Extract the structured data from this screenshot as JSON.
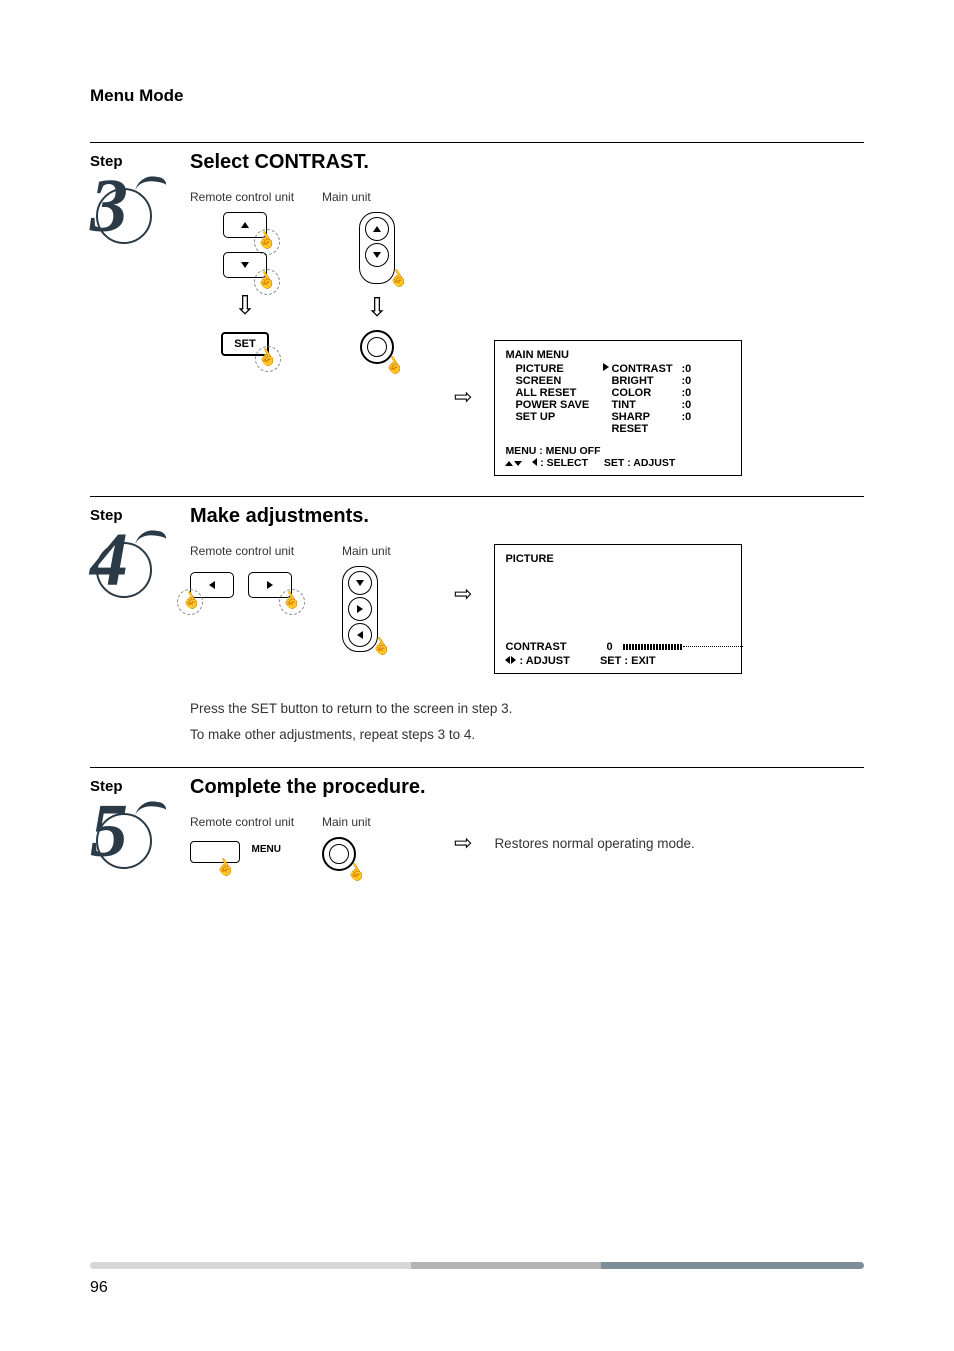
{
  "header": "Menu Mode",
  "page_number": "96",
  "labels": {
    "step": "Step",
    "remote": "Remote control unit",
    "main": "Main unit",
    "set": "SET",
    "menu": "MENU"
  },
  "step3": {
    "heading": "Select CONTRAST.",
    "osd": {
      "title": "MAIN MENU",
      "left": [
        "PICTURE",
        "SCREEN",
        "ALL RESET",
        "POWER SAVE",
        "SET UP"
      ],
      "right": [
        {
          "k": "CONTRAST",
          "c": ":",
          "v": "0",
          "sel": true
        },
        {
          "k": "BRIGHT",
          "c": ":",
          "v": "0"
        },
        {
          "k": "COLOR",
          "c": ":",
          "v": "0"
        },
        {
          "k": "TINT",
          "c": ":",
          "v": "0"
        },
        {
          "k": "SHARP",
          "c": ":",
          "v": "0"
        },
        {
          "k": "RESET",
          "c": "",
          "v": ""
        }
      ],
      "foot1": "MENU : MENU OFF",
      "foot2_select": " : SELECT",
      "foot2_adjust": "SET : ADJUST"
    }
  },
  "step4": {
    "heading": "Make adjustments.",
    "osd": {
      "title": "PICTURE",
      "param": "CONTRAST",
      "value": "0",
      "foot_left": " : ADJUST",
      "foot_right": "SET : EXIT"
    },
    "body1": "Press the SET button to return to the screen in step 3.",
    "body2": "To make other adjustments, repeat steps 3 to 4."
  },
  "step5": {
    "heading": "Complete the procedure.",
    "result": "Restores normal operating mode."
  }
}
